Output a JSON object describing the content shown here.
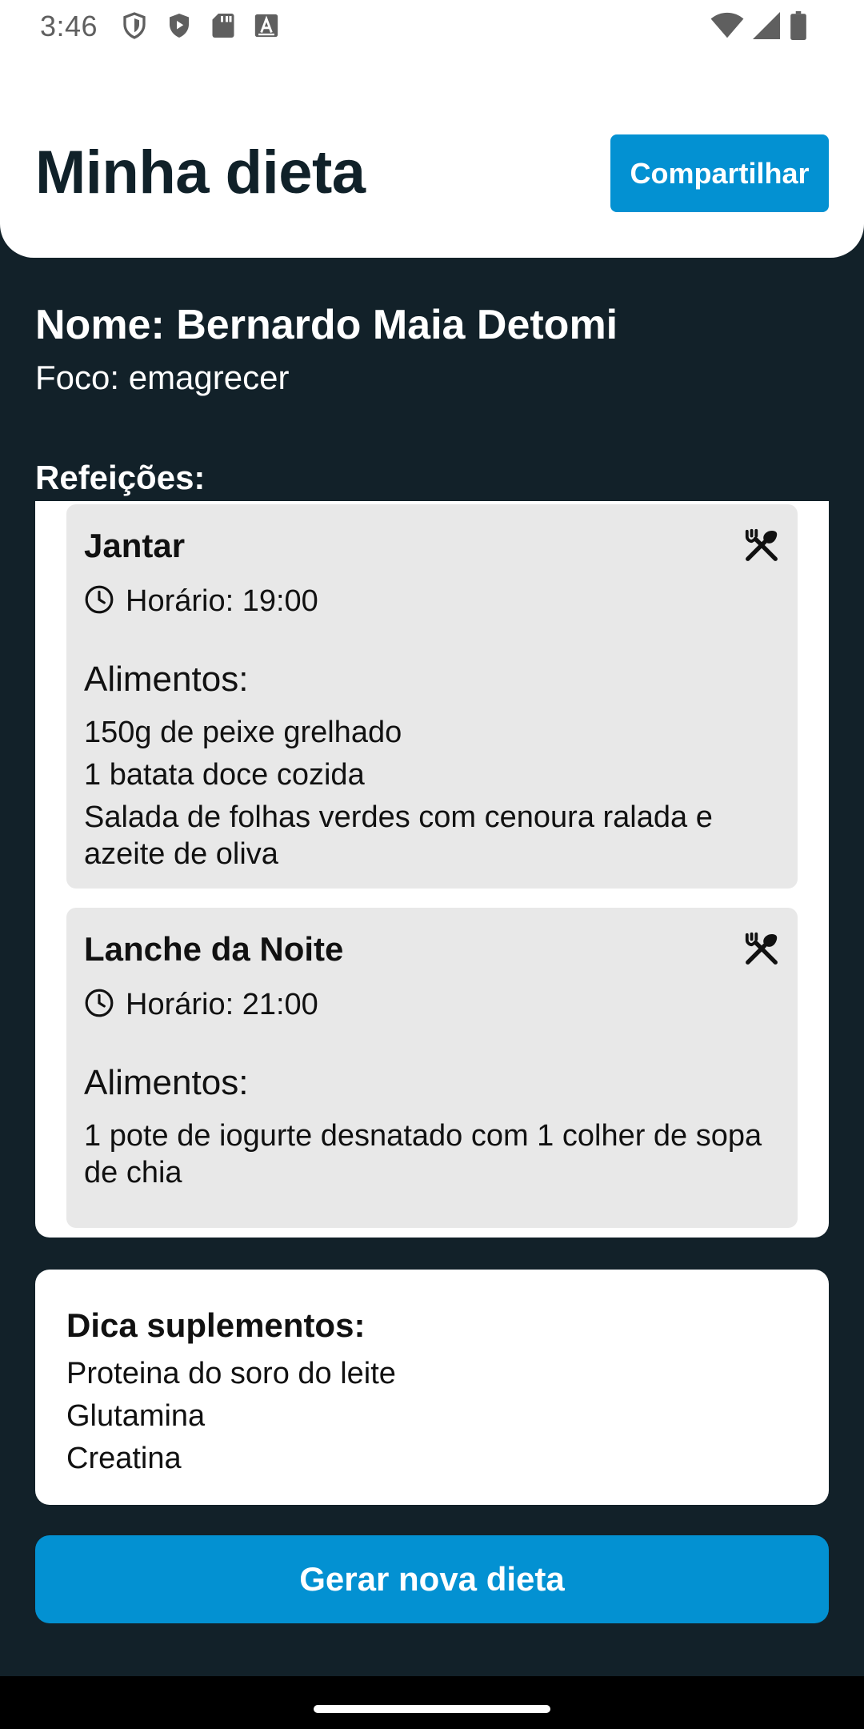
{
  "status_bar": {
    "time": "3:46",
    "left_icons": [
      "shield-icon",
      "play-protect-icon",
      "sd-card-icon",
      "font-a-icon"
    ],
    "right_icons": [
      "wifi-icon",
      "cellular-signal-icon",
      "battery-icon"
    ]
  },
  "header": {
    "title": "Minha dieta",
    "share_label": "Compartilhar"
  },
  "profile": {
    "name": "Nome: Bernardo Maia Detomi",
    "focus": "Foco: emagrecer"
  },
  "meals": {
    "heading": "Refeições:",
    "items": [
      {
        "name": "Jantar",
        "time": "Horário: 19:00",
        "foods_label": "Alimentos:",
        "foods": [
          "150g de peixe grelhado",
          "1 batata doce cozida",
          "Salada de folhas verdes com cenoura ralada e azeite de oliva"
        ],
        "icon": "utensils-crossed-icon"
      },
      {
        "name": "Lanche da Noite",
        "time": "Horário: 21:00",
        "foods_label": "Alimentos:",
        "foods": [
          "1 pote de iogurte desnatado com 1 colher de sopa de chia"
        ],
        "icon": "utensils-crossed-icon"
      }
    ]
  },
  "supplements": {
    "title": "Dica suplementos:",
    "items": [
      "Proteina do soro do leite",
      "Glutamina",
      "Creatina"
    ]
  },
  "actions": {
    "generate_label": "Gerar nova dieta"
  },
  "colors": {
    "background": "#122129",
    "accent": "#0391d2",
    "card": "#e8e8e8"
  }
}
